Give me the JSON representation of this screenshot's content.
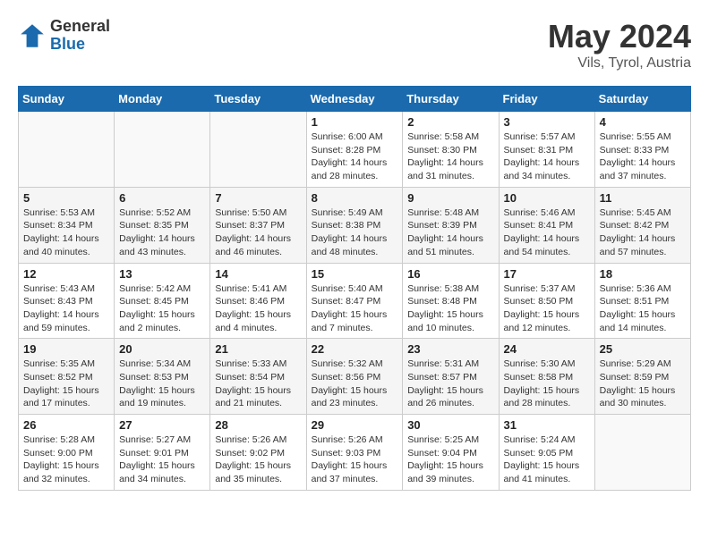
{
  "header": {
    "logo_general": "General",
    "logo_blue": "Blue",
    "month_year": "May 2024",
    "location": "Vils, Tyrol, Austria"
  },
  "weekdays": [
    "Sunday",
    "Monday",
    "Tuesday",
    "Wednesday",
    "Thursday",
    "Friday",
    "Saturday"
  ],
  "weeks": [
    [
      {
        "day": "",
        "info": ""
      },
      {
        "day": "",
        "info": ""
      },
      {
        "day": "",
        "info": ""
      },
      {
        "day": "1",
        "info": "Sunrise: 6:00 AM\nSunset: 8:28 PM\nDaylight: 14 hours\nand 28 minutes."
      },
      {
        "day": "2",
        "info": "Sunrise: 5:58 AM\nSunset: 8:30 PM\nDaylight: 14 hours\nand 31 minutes."
      },
      {
        "day": "3",
        "info": "Sunrise: 5:57 AM\nSunset: 8:31 PM\nDaylight: 14 hours\nand 34 minutes."
      },
      {
        "day": "4",
        "info": "Sunrise: 5:55 AM\nSunset: 8:33 PM\nDaylight: 14 hours\nand 37 minutes."
      }
    ],
    [
      {
        "day": "5",
        "info": "Sunrise: 5:53 AM\nSunset: 8:34 PM\nDaylight: 14 hours\nand 40 minutes."
      },
      {
        "day": "6",
        "info": "Sunrise: 5:52 AM\nSunset: 8:35 PM\nDaylight: 14 hours\nand 43 minutes."
      },
      {
        "day": "7",
        "info": "Sunrise: 5:50 AM\nSunset: 8:37 PM\nDaylight: 14 hours\nand 46 minutes."
      },
      {
        "day": "8",
        "info": "Sunrise: 5:49 AM\nSunset: 8:38 PM\nDaylight: 14 hours\nand 48 minutes."
      },
      {
        "day": "9",
        "info": "Sunrise: 5:48 AM\nSunset: 8:39 PM\nDaylight: 14 hours\nand 51 minutes."
      },
      {
        "day": "10",
        "info": "Sunrise: 5:46 AM\nSunset: 8:41 PM\nDaylight: 14 hours\nand 54 minutes."
      },
      {
        "day": "11",
        "info": "Sunrise: 5:45 AM\nSunset: 8:42 PM\nDaylight: 14 hours\nand 57 minutes."
      }
    ],
    [
      {
        "day": "12",
        "info": "Sunrise: 5:43 AM\nSunset: 8:43 PM\nDaylight: 14 hours\nand 59 minutes."
      },
      {
        "day": "13",
        "info": "Sunrise: 5:42 AM\nSunset: 8:45 PM\nDaylight: 15 hours\nand 2 minutes."
      },
      {
        "day": "14",
        "info": "Sunrise: 5:41 AM\nSunset: 8:46 PM\nDaylight: 15 hours\nand 4 minutes."
      },
      {
        "day": "15",
        "info": "Sunrise: 5:40 AM\nSunset: 8:47 PM\nDaylight: 15 hours\nand 7 minutes."
      },
      {
        "day": "16",
        "info": "Sunrise: 5:38 AM\nSunset: 8:48 PM\nDaylight: 15 hours\nand 10 minutes."
      },
      {
        "day": "17",
        "info": "Sunrise: 5:37 AM\nSunset: 8:50 PM\nDaylight: 15 hours\nand 12 minutes."
      },
      {
        "day": "18",
        "info": "Sunrise: 5:36 AM\nSunset: 8:51 PM\nDaylight: 15 hours\nand 14 minutes."
      }
    ],
    [
      {
        "day": "19",
        "info": "Sunrise: 5:35 AM\nSunset: 8:52 PM\nDaylight: 15 hours\nand 17 minutes."
      },
      {
        "day": "20",
        "info": "Sunrise: 5:34 AM\nSunset: 8:53 PM\nDaylight: 15 hours\nand 19 minutes."
      },
      {
        "day": "21",
        "info": "Sunrise: 5:33 AM\nSunset: 8:54 PM\nDaylight: 15 hours\nand 21 minutes."
      },
      {
        "day": "22",
        "info": "Sunrise: 5:32 AM\nSunset: 8:56 PM\nDaylight: 15 hours\nand 23 minutes."
      },
      {
        "day": "23",
        "info": "Sunrise: 5:31 AM\nSunset: 8:57 PM\nDaylight: 15 hours\nand 26 minutes."
      },
      {
        "day": "24",
        "info": "Sunrise: 5:30 AM\nSunset: 8:58 PM\nDaylight: 15 hours\nand 28 minutes."
      },
      {
        "day": "25",
        "info": "Sunrise: 5:29 AM\nSunset: 8:59 PM\nDaylight: 15 hours\nand 30 minutes."
      }
    ],
    [
      {
        "day": "26",
        "info": "Sunrise: 5:28 AM\nSunset: 9:00 PM\nDaylight: 15 hours\nand 32 minutes."
      },
      {
        "day": "27",
        "info": "Sunrise: 5:27 AM\nSunset: 9:01 PM\nDaylight: 15 hours\nand 34 minutes."
      },
      {
        "day": "28",
        "info": "Sunrise: 5:26 AM\nSunset: 9:02 PM\nDaylight: 15 hours\nand 35 minutes."
      },
      {
        "day": "29",
        "info": "Sunrise: 5:26 AM\nSunset: 9:03 PM\nDaylight: 15 hours\nand 37 minutes."
      },
      {
        "day": "30",
        "info": "Sunrise: 5:25 AM\nSunset: 9:04 PM\nDaylight: 15 hours\nand 39 minutes."
      },
      {
        "day": "31",
        "info": "Sunrise: 5:24 AM\nSunset: 9:05 PM\nDaylight: 15 hours\nand 41 minutes."
      },
      {
        "day": "",
        "info": ""
      }
    ]
  ]
}
